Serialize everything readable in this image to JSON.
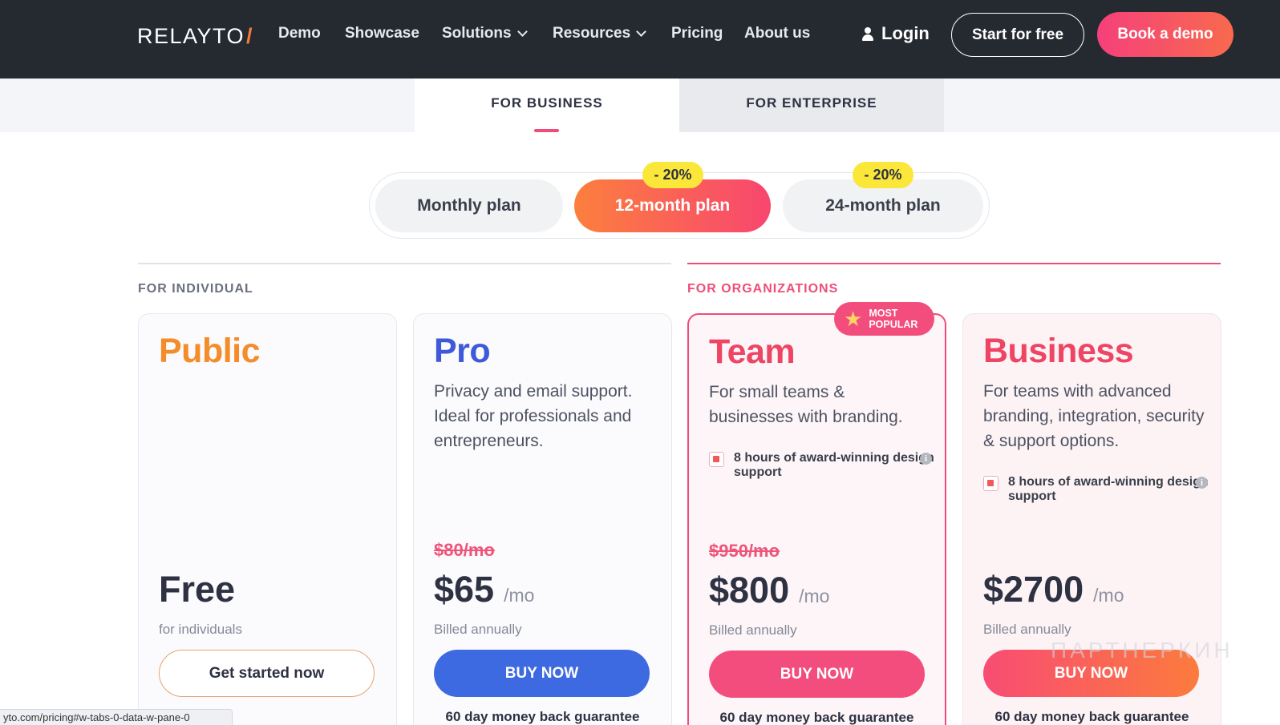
{
  "header": {
    "logo": "RELAYTO",
    "logo_slash": "/",
    "nav": [
      "Demo",
      "Showcase",
      "Solutions",
      "Resources",
      "Pricing",
      "About us"
    ],
    "login": "Login",
    "start_free": "Start for free",
    "book_demo": "Book a demo"
  },
  "tabs": {
    "business": "FOR BUSINESS",
    "enterprise": "FOR ENTERPRISE"
  },
  "plans_toggle": {
    "monthly": "Monthly plan",
    "twelve": "12-month plan",
    "twentyfour": "24-month plan",
    "discount_12": "- 20%",
    "discount_24": "- 20%"
  },
  "sections": {
    "individual": "FOR INDIVIDUAL",
    "organizations": "FOR ORGANIZATIONS"
  },
  "badge": {
    "line1": "MOST",
    "line2": "POPULAR"
  },
  "cards": {
    "public": {
      "name": "Public",
      "price": "Free",
      "billed": "for individuals",
      "cta": "Get started now",
      "color": "#f48c2a"
    },
    "pro": {
      "name": "Pro",
      "desc": "Privacy and email support. Ideal for professionals and entrepreneurs.",
      "old_price": "$80/mo",
      "price": "$65",
      "per": "/mo",
      "billed": "Billed annually",
      "cta": "BUY NOW",
      "guarantee": "60 day money back guarantee",
      "color": "#3f5ad8"
    },
    "team": {
      "name": "Team",
      "desc": "For small teams & businesses with branding.",
      "feature": "8 hours of award-winning design support",
      "old_price": "$950/mo",
      "price": "$800",
      "per": "/mo",
      "billed": "Billed annually",
      "cta": "BUY NOW",
      "guarantee": "60 day money back guarantee",
      "color": "#ee4565"
    },
    "business": {
      "name": "Business",
      "desc": "For teams with advanced branding, integration, security & support options.",
      "feature": "8 hours of award-winning design support",
      "price": "$2700",
      "per": "/mo",
      "billed": "Billed annually",
      "cta": "BUY NOW",
      "guarantee": "60 day money back guarantee",
      "color": "#ee4565"
    }
  },
  "status_url": "yto.com/pricing#w-tabs-0-data-w-pane-0",
  "watermark": "ПАРТНЕРКИН"
}
